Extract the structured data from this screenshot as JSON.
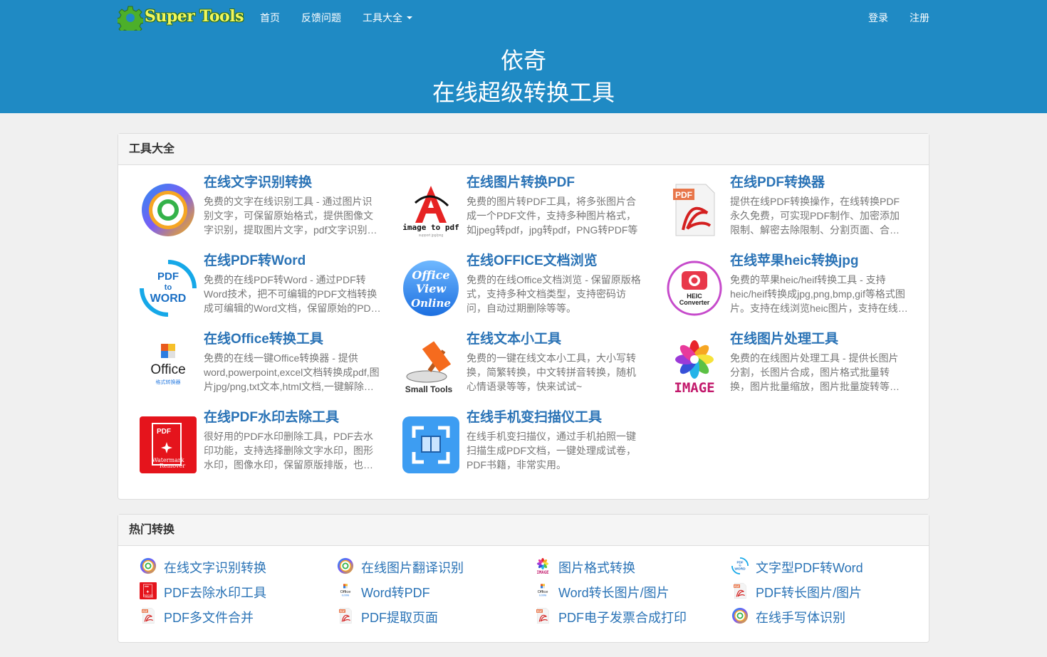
{
  "header": {
    "logo": "Super Tools",
    "nav": [
      {
        "label": "首页"
      },
      {
        "label": "反馈问题"
      },
      {
        "label": "工具大全"
      }
    ],
    "login": "登录",
    "register": "注册",
    "title_line1": "依奇",
    "title_line2": "在线超级转换工具"
  },
  "tools_panel": {
    "heading": "工具大全",
    "tools": [
      {
        "title": "在线文字识别转换",
        "desc": "免费的文字在线识别工具 - 通过图片识别文字，可保留原始格式，提供图像文字识别，提取图片文字，pdf文字识别等功能",
        "icon": "ocr-ring-icon"
      },
      {
        "title": "在线图片转换PDF",
        "desc": "免费的图片转PDF工具，将多张图片合成一个PDF文件，支持多种图片格式，如jpeg转pdf，jpg转pdf，PNG转PDF等",
        "icon": "image-to-pdf-icon"
      },
      {
        "title": "在线PDF转换器",
        "desc": "提供在线PDF转换操作，在线转换PDF永久免费，可实现PDF制作、加密添加限制、解密去除限制、分割页面、合并文件等",
        "icon": "pdf-file-icon"
      },
      {
        "title": "在线PDF转Word",
        "desc": "免费的在线PDF转Word - 通过PDF转Word技术，把不可编辑的PDF文档转换成可编辑的Word文档，保留原始的PDF格式",
        "icon": "pdf-to-word-icon"
      },
      {
        "title": "在线OFFICE文档浏览",
        "desc": "免费的在线Office文档浏览 - 保留原版格式，支持多种文档类型，支持密码访问，自动过期删除等等。",
        "icon": "office-view-online-icon"
      },
      {
        "title": "在线苹果heic转换jpg",
        "desc": "免费的苹果heic/heif转换工具 - 支持heic/heif转换成jpg,png,bmp,gif等格式图片。支持在线浏览heic图片，支持在线转换",
        "icon": "heic-converter-icon"
      },
      {
        "title": "在线Office转换工具",
        "desc": "免费的在线一键Office转换器 - 提供word,powerpoint,excel文档转换成pdf,图片jpg/png,txt文本,html文档,一键解除限制",
        "icon": "office-converter-icon"
      },
      {
        "title": "在线文本小工具",
        "desc": "免费的一键在线文本小工具，大小写转换，简繁转换，中文转拼音转换，随机心情语录等等，快来试试~",
        "icon": "small-tools-hammer-icon"
      },
      {
        "title": "在线图片处理工具",
        "desc": "免费的在线图片处理工具 - 提供长图片分割，长图片合成，图片格式批量转换，图片批量缩放，图片批量旋转等功能",
        "icon": "image-flower-icon"
      },
      {
        "title": "在线PDF水印去除工具",
        "desc": "很好用的PDF水印删除工具，PDF去水印功能，支持选择删除文字水印，图形水印，图像水印，保留原版排版，也可以去除",
        "icon": "watermark-remover-icon"
      },
      {
        "title": "在线手机变扫描仪工具",
        "desc": "在线手机变扫描仪，通过手机拍照一键扫描生成PDF文档，一键处理成试卷，PDF书籍，非常实用。",
        "icon": "scanner-icon"
      }
    ]
  },
  "hot_panel": {
    "heading": "热门转换",
    "items": [
      {
        "label": "在线文字识别转换",
        "icon": "ocr-ring-icon"
      },
      {
        "label": "在线图片翻译识别",
        "icon": "ocr-ring-icon"
      },
      {
        "label": "图片格式转换",
        "icon": "image-flower-icon"
      },
      {
        "label": "文字型PDF转Word",
        "icon": "pdf-to-word-icon"
      },
      {
        "label": "PDF去除水印工具",
        "icon": "watermark-remover-icon"
      },
      {
        "label": "Word转PDF",
        "icon": "office-converter-icon"
      },
      {
        "label": "Word转长图片/图片",
        "icon": "office-converter-icon"
      },
      {
        "label": "PDF转长图片/图片",
        "icon": "pdf-file-icon"
      },
      {
        "label": "PDF多文件合并",
        "icon": "pdf-file-icon"
      },
      {
        "label": "PDF提取页面",
        "icon": "pdf-file-icon"
      },
      {
        "label": "PDF电子发票合成打印",
        "icon": "pdf-file-icon"
      },
      {
        "label": "在线手写体识别",
        "icon": "ocr-ring-icon"
      }
    ]
  },
  "colors": {
    "header_bg": "#1f8ac4",
    "link": "#2a73b6",
    "desc": "#777777"
  }
}
